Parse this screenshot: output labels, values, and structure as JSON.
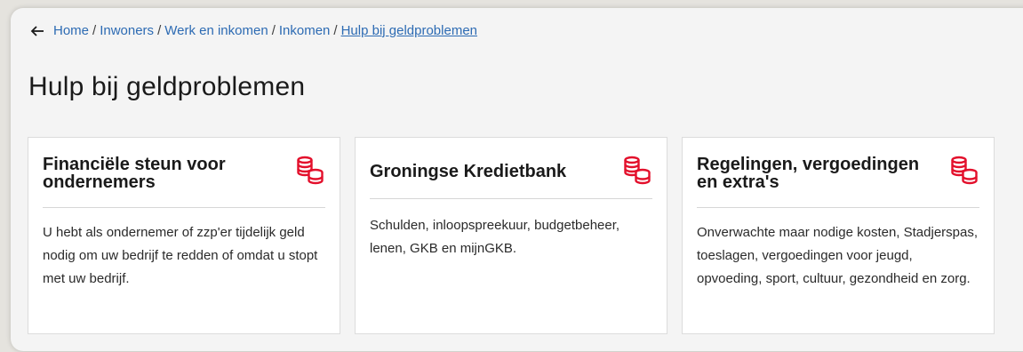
{
  "breadcrumb": {
    "items": [
      {
        "label": "Home"
      },
      {
        "label": "Inwoners"
      },
      {
        "label": "Werk en inkomen"
      },
      {
        "label": "Inkomen"
      },
      {
        "label": "Hulp bij geldproblemen"
      }
    ],
    "separator": "/",
    "link_color": "#2d6bb3"
  },
  "page": {
    "title": "Hulp bij geldproblemen"
  },
  "cards": [
    {
      "title": "Financiële steun voor ondernemers",
      "description": "U hebt als ondernemer of zzp'er tijdelijk geld nodig om uw bedrijf te redden of omdat u stopt met uw bedrijf.",
      "icon": "coins-icon"
    },
    {
      "title": "Groningse Kredietbank",
      "description": "Schulden, inloopspreekuur, budgetbeheer, lenen, GKB en mijnGKB.",
      "icon": "coins-icon"
    },
    {
      "title": "Regelingen, vergoedingen en extra's",
      "description": "Onverwachte maar nodige kosten, Stadjerspas, toeslagen, vergoedingen voor jeugd, opvoeding, sport, cultuur, gezondheid en zorg.",
      "icon": "coins-icon"
    }
  ],
  "colors": {
    "icon_red": "#e3102c",
    "panel_bg": "#f4f4f4",
    "card_bg": "#ffffff"
  }
}
